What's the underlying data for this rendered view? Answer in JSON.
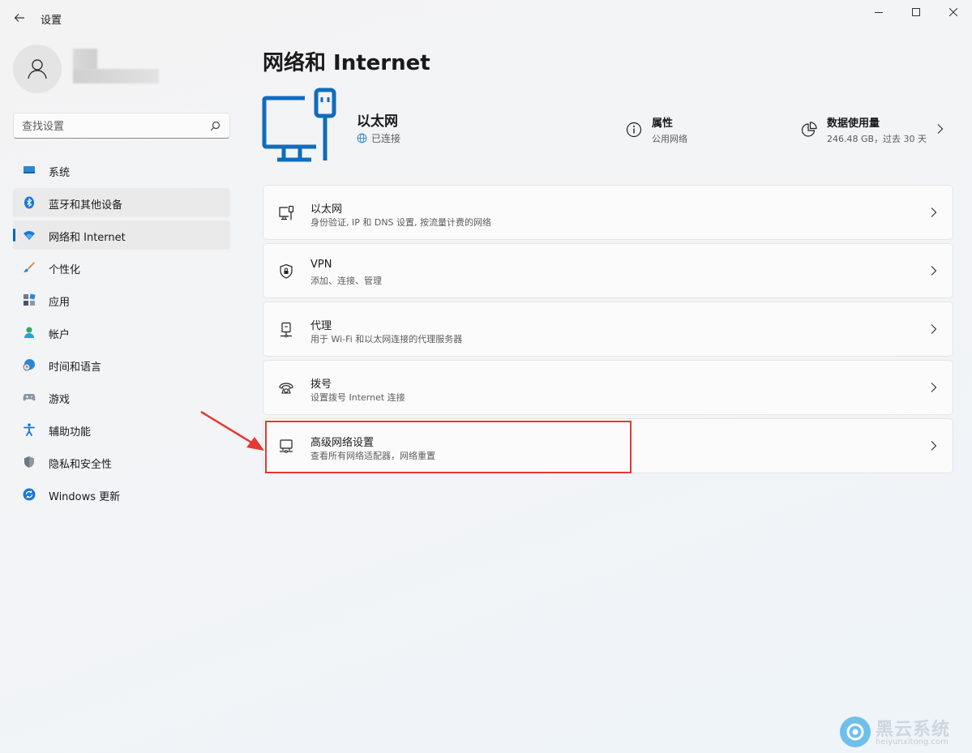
{
  "app": {
    "title": "设置"
  },
  "search": {
    "placeholder": "查找设置"
  },
  "sidebar": {
    "items": [
      {
        "label": "系统"
      },
      {
        "label": "蓝牙和其他设备"
      },
      {
        "label": "网络和 Internet"
      },
      {
        "label": "个性化"
      },
      {
        "label": "应用"
      },
      {
        "label": "帐户"
      },
      {
        "label": "时间和语言"
      },
      {
        "label": "游戏"
      },
      {
        "label": "辅助功能"
      },
      {
        "label": "隐私和安全性"
      },
      {
        "label": "Windows 更新"
      }
    ]
  },
  "main": {
    "title": "网络和 Internet",
    "hero": {
      "name": "以太网",
      "status": "已连接"
    },
    "properties": {
      "title": "属性",
      "sub": "公用网络"
    },
    "data_usage": {
      "title": "数据使用量",
      "sub": "246.48 GB，过去 30 天"
    },
    "cards": [
      {
        "title": "以太网",
        "sub": "身份验证, IP 和 DNS 设置, 按流量计费的网络"
      },
      {
        "title": "VPN",
        "sub": "添加、连接、管理"
      },
      {
        "title": "代理",
        "sub": "用于 Wi-Fi 和以太网连接的代理服务器"
      },
      {
        "title": "拨号",
        "sub": "设置拨号 Internet 连接"
      },
      {
        "title": "高级网络设置",
        "sub": "查看所有网络适配器，网络重置"
      }
    ]
  },
  "watermark": {
    "brand": "黑云系统",
    "url": "heiyunxitong.com"
  },
  "colors": {
    "accent": "#0067c0",
    "annotation": "#e53935"
  }
}
